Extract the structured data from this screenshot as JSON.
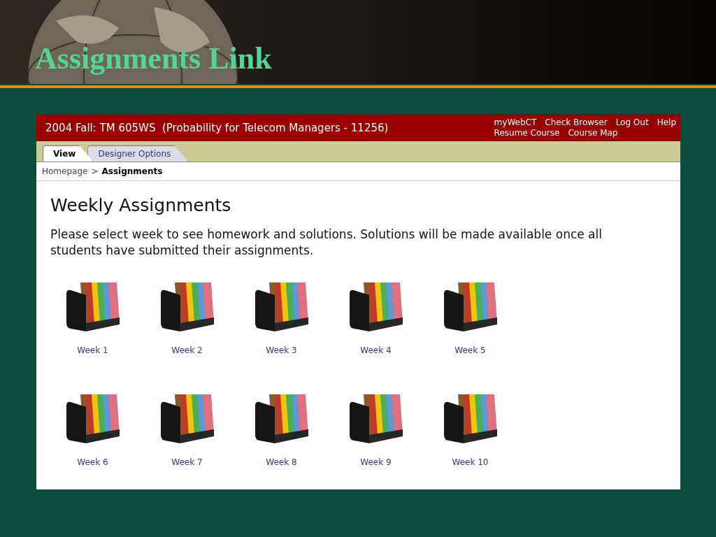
{
  "slide": {
    "title": "Assignments Link"
  },
  "course_bar": {
    "title": "2004 Fall: TM 605WS  (Probability for Telecom Managers - 11256)",
    "links_top": [
      "myWebCT",
      "Check Browser",
      "Log Out",
      "Help"
    ],
    "links_bottom": [
      "Resume Course",
      "Course Map"
    ]
  },
  "tabs": [
    {
      "label": "View",
      "selected": true
    },
    {
      "label": "Designer Options",
      "selected": false
    }
  ],
  "breadcrumb": {
    "separator": ">",
    "items": [
      {
        "label": "Homepage",
        "current": false
      },
      {
        "label": "Assignments",
        "current": true
      }
    ]
  },
  "heading": "Weekly Assignments",
  "description": "Please select week to see homework and solutions. Solutions will be made available once all students have submitted their assignments.",
  "weeks": [
    {
      "label": "Week 1"
    },
    {
      "label": "Week 2"
    },
    {
      "label": "Week 3"
    },
    {
      "label": "Week 4"
    },
    {
      "label": "Week 5"
    },
    {
      "label": "Week 6"
    },
    {
      "label": "Week 7"
    },
    {
      "label": "Week 8"
    },
    {
      "label": "Week 9"
    },
    {
      "label": "Week 10"
    }
  ]
}
